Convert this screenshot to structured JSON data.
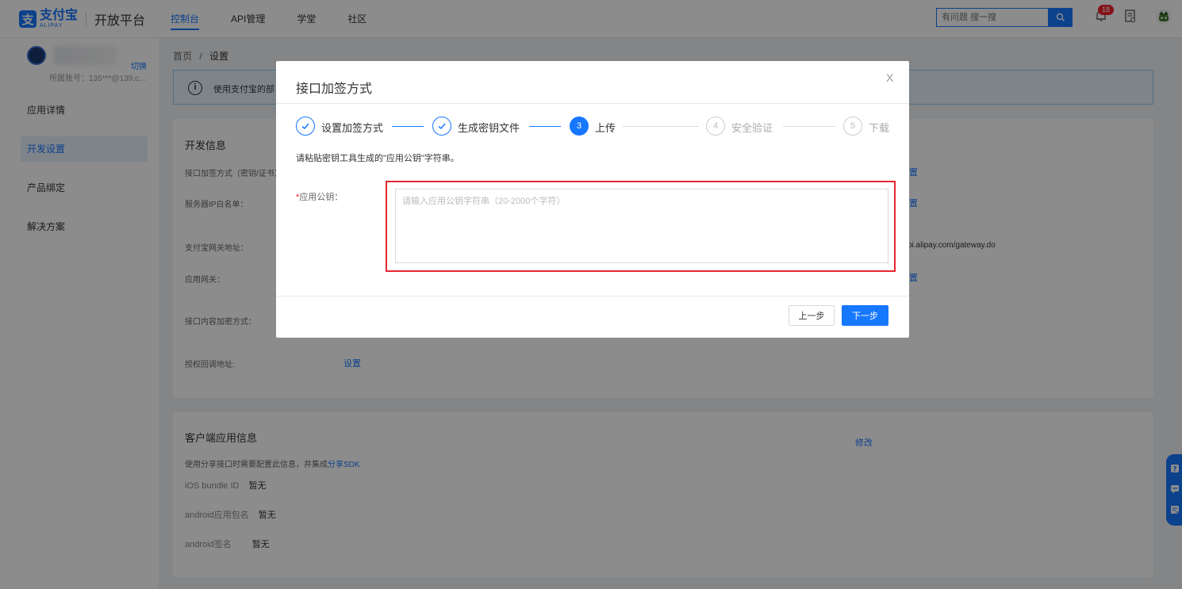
{
  "brand": {
    "logo_char": "支",
    "name_cn": "支付宝",
    "name_en": "ALIPAY",
    "platform": "开放平台",
    "color": "#1677ff"
  },
  "topnav": {
    "items": [
      {
        "label": "控制台",
        "active": true
      },
      {
        "label": "API管理",
        "active": false
      },
      {
        "label": "学堂",
        "active": false
      },
      {
        "label": "社区",
        "active": false
      }
    ],
    "search_placeholder": "有问题 搜一搜",
    "notification_count": "18"
  },
  "sidebar": {
    "switch_label": "切换",
    "account": "所属账号：135***@139.c...",
    "items": [
      {
        "label": "应用详情",
        "active": false
      },
      {
        "label": "开发设置",
        "active": true
      },
      {
        "label": "产品绑定",
        "active": false
      },
      {
        "label": "解决方案",
        "active": false
      }
    ]
  },
  "breadcrumb": {
    "home": "首页",
    "sep": "/",
    "current": "设置"
  },
  "notice": {
    "icon": "i",
    "text": "使用支付宝的部"
  },
  "dev_info": {
    "title": "开发信息",
    "rows": [
      {
        "label": "接口加签方式（密钥/证书）"
      },
      {
        "label": "服务器IP白名单："
      },
      {
        "label": "支付宝网关地址："
      },
      {
        "label": "应用网关："
      },
      {
        "label": "接口内容加密方式："
      },
      {
        "label": "授权回调地址:"
      }
    ],
    "set_label": "设置",
    "set_partial": "置",
    "gateway_partial": "pi.alipay.com/gateway.do"
  },
  "client_info": {
    "title": "客户端应用信息",
    "edit_label": "修改",
    "desc_prefix": "使用分享接口时需要配置此信息，并集成",
    "desc_link": "分享SDK",
    "rows": [
      {
        "label": "iOS bundle ID",
        "value": "暂无"
      },
      {
        "label": "android应用包名",
        "value": "暂无"
      },
      {
        "label": "android签名",
        "value": "暂无"
      }
    ]
  },
  "modal": {
    "title": "接口加签方式",
    "close": "X",
    "steps": [
      {
        "num": "",
        "label": "设置加签方式",
        "state": "done"
      },
      {
        "num": "",
        "label": "生成密钥文件",
        "state": "done"
      },
      {
        "num": "3",
        "label": "上传",
        "state": "current"
      },
      {
        "num": "4",
        "label": "安全验证",
        "state": "wait"
      },
      {
        "num": "5",
        "label": "下载",
        "state": "wait"
      }
    ],
    "hint": "请粘贴密钥工具生成的\"应用公钥\"字符串。",
    "field_required_mark": "*",
    "field_label": "应用公钥：",
    "field_placeholder": "请输入应用公钥字符串（20-2000个字符）",
    "field_value": "",
    "highlight_color": "#e5262d",
    "prev_label": "上一步",
    "next_label": "下一步"
  }
}
